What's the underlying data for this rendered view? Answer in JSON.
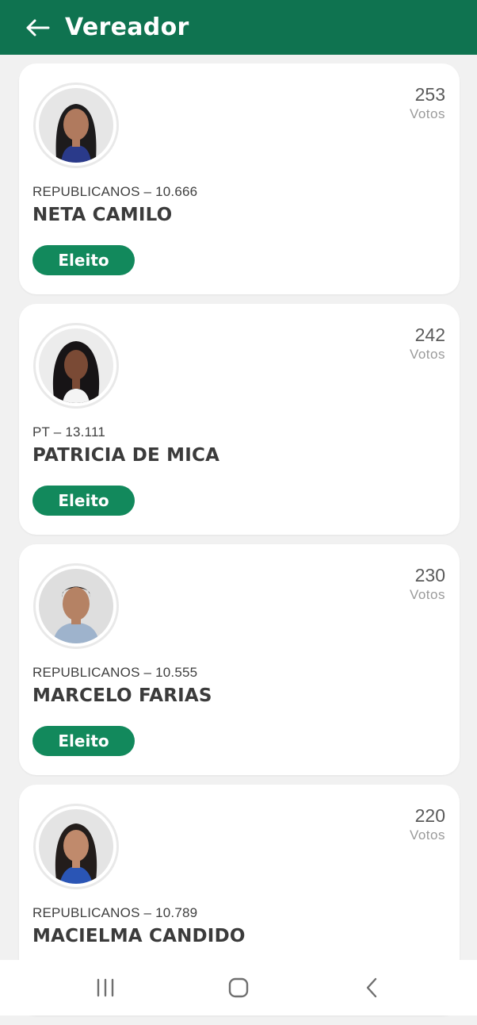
{
  "header": {
    "title": "Vereador",
    "back_icon": "arrow-left-icon"
  },
  "colors": {
    "app_bar": "#0f7350",
    "badge": "#12895c",
    "background": "#f1f1f1"
  },
  "candidates": [
    {
      "party_number": "REPUBLICANOS – 10.666",
      "name": "NETA CAMILO",
      "votes": "253",
      "votes_label": "Votos",
      "status": "Eleito"
    },
    {
      "party_number": "PT – 13.111",
      "name": "PATRICIA DE MICA",
      "votes": "242",
      "votes_label": "Votos",
      "status": "Eleito"
    },
    {
      "party_number": "REPUBLICANOS – 10.555",
      "name": "MARCELO FARIAS",
      "votes": "230",
      "votes_label": "Votos",
      "status": "Eleito"
    },
    {
      "party_number": "REPUBLICANOS – 10.789",
      "name": "MACIELMA CANDIDO",
      "votes": "220",
      "votes_label": "Votos",
      "status": ""
    }
  ],
  "system_nav": {
    "recents_icon": "recents-icon",
    "home_icon": "home-icon",
    "back_icon": "back-chevron-icon"
  }
}
